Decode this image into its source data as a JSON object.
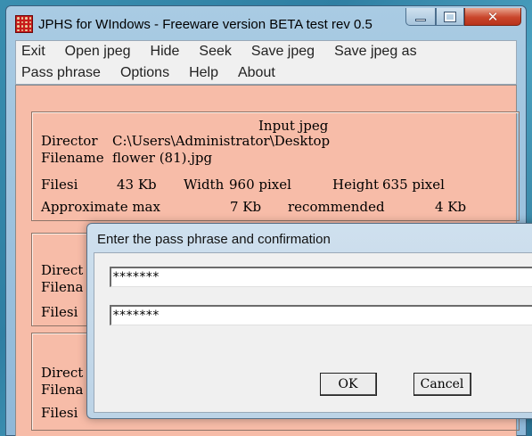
{
  "window": {
    "title": "JPHS for WIndows - Freeware version BETA test rev 0.5",
    "icon": "app-icon-jphs",
    "controls": {
      "minimize": "minimize-icon",
      "maximize": "maximize-icon",
      "close": "close-icon"
    }
  },
  "menu": {
    "row1": [
      "Exit",
      "Open jpeg",
      "Hide",
      "Seek",
      "Save jpeg",
      "Save jpeg as"
    ],
    "row2": [
      "Pass phrase",
      "Options",
      "Help",
      "About"
    ]
  },
  "input_group": {
    "heading": "Input jpeg",
    "directory_label": "Director",
    "directory_value": "C:\\Users\\Administrator\\Desktop",
    "filename_label": "Filename",
    "filename_value": "flower (81).jpg",
    "filesize_label": "Filesi",
    "filesize_value": "43 Kb",
    "width_label": "Width",
    "width_value": "960 pixel",
    "height_label": "Height",
    "height_value": "635 pixel",
    "approx_label": "Approximate max",
    "approx_value": "7 Kb",
    "recommended_label": "recommended",
    "recommended_value": "4 Kb"
  },
  "group2": {
    "directory_label": "Direct",
    "filename_label": "Filena",
    "filesize_label": "Filesi"
  },
  "group3": {
    "directory_label": "Direct",
    "filename_label": "Filena",
    "filesize_label": "Filesi"
  },
  "dialog": {
    "title": "Enter the pass phrase and confirmation",
    "pass_phrase": "*******",
    "confirmation": "*******",
    "ok_label": "OK",
    "cancel_label": "Cancel"
  },
  "colors": {
    "client_bg": "#f7bca8",
    "menu_bg": "#f0f0f0",
    "close_button": "#c9452b"
  }
}
